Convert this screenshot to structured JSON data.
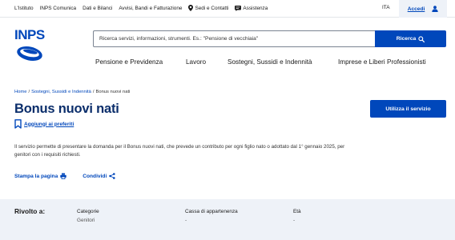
{
  "topbar": {
    "links": [
      {
        "label": "L'Istituto"
      },
      {
        "label": "INPS Comunica"
      },
      {
        "label": "Dati e Bilanci"
      },
      {
        "label": "Avvisi, Bandi e Fatturazione"
      },
      {
        "label": "Sedi e Contatti",
        "icon": "location-pin-icon"
      },
      {
        "label": "Assistenza",
        "icon": "chat-icon"
      }
    ],
    "language": "ITA",
    "login_label": "Accedi",
    "login_icon": "user-icon"
  },
  "header": {
    "logo_text": "INPS",
    "search": {
      "placeholder": "Ricerca servizi, informazioni, strumenti. Es.: \"Pensione di vecchiaia\"",
      "button_label": "Ricerca",
      "button_icon": "search-icon"
    },
    "nav": [
      {
        "label": "Pensione e Previdenza"
      },
      {
        "label": "Lavoro"
      },
      {
        "label": "Sostegni, Sussidi e Indennità"
      },
      {
        "label": "Imprese e Liberi Professionisti"
      }
    ]
  },
  "breadcrumb": {
    "items": [
      "Home",
      "Sostegni, Sussidi e Indennità",
      "Bonus nuovi nati"
    ],
    "separator": "/"
  },
  "page": {
    "title": "Bonus nuovi nati",
    "favorite_label": "Aggiungi ai preferiti",
    "cta_label": "Utilizza il servizio",
    "description": "Il servizio permette di presentare la domanda per il Bonus nuovi nati, che prevede un contributo per ogni figlio nato o adottato dal 1° gennaio 2025, per genitori con i requisiti richiesti.",
    "actions": {
      "print_label": "Stampa la pagina",
      "share_label": "Condividi"
    }
  },
  "rivolto": {
    "heading": "Rivolto a:",
    "columns": [
      {
        "key": "Categorie",
        "value": "Genitori"
      },
      {
        "key": "Cassa di appartenenza",
        "value": "-"
      },
      {
        "key": "Età",
        "value": "-"
      }
    ]
  },
  "colors": {
    "primary": "#0047bb",
    "title": "#0b2e6b",
    "band": "#eef2f8"
  }
}
